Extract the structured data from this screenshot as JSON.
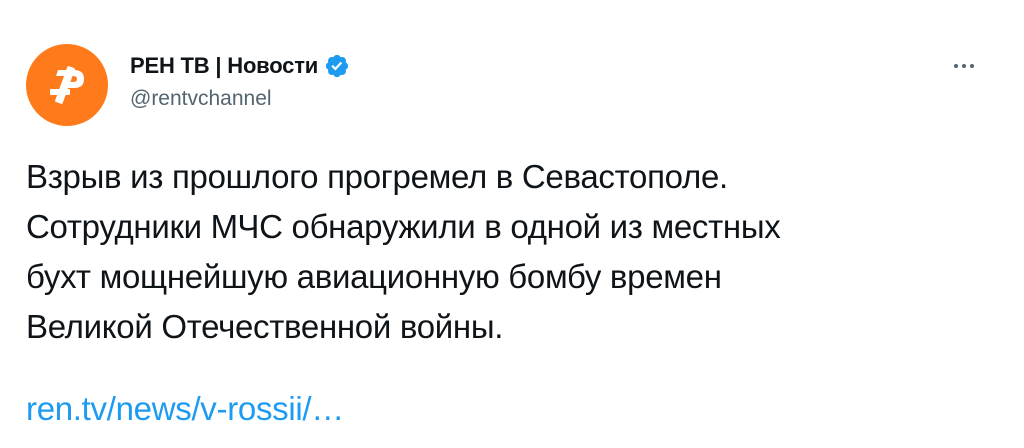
{
  "author": {
    "display_name": "РЕН ТВ | Новости",
    "handle": "@rentvchannel",
    "verified": true,
    "avatar_color": "#ff7a1a",
    "avatar_icon": "rentv-logo-icon"
  },
  "tweet": {
    "text_lines": [
      "Взрыв из прошлого прогремел в Севастополе.",
      "Сотрудники МЧС обнаружили в одной из местных",
      "бухт мощнейшую авиационную бомбу времен",
      "Великой Отечественной войны."
    ],
    "link_text": "ren.tv/news/v-rossii/…"
  },
  "menu": {
    "more_icon": "more-options-icon"
  },
  "colors": {
    "text": "#0f1419",
    "secondary": "#536471",
    "link": "#1d9bf0",
    "verified_badge": "#1d9bf0",
    "background": "#ffffff"
  }
}
